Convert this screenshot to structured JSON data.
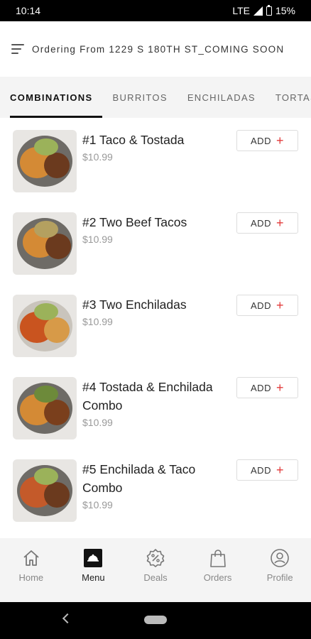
{
  "status_bar": {
    "time": "10:14",
    "network": "LTE",
    "battery": "15%"
  },
  "header": {
    "text": "Ordering From 1229 S 180TH ST_COMING SOON"
  },
  "tabs": [
    {
      "label": "COMBINATIONS",
      "active": true
    },
    {
      "label": "BURRITOS",
      "active": false
    },
    {
      "label": "ENCHILADAS",
      "active": false
    },
    {
      "label": "TORTAS",
      "active": false
    }
  ],
  "items": [
    {
      "name": "#1 Taco & Tostada",
      "price": "$10.99",
      "add_label": "ADD"
    },
    {
      "name": "#2 Two Beef Tacos",
      "price": "$10.99",
      "add_label": "ADD"
    },
    {
      "name": "#3 Two Enchiladas",
      "price": "$10.99",
      "add_label": "ADD"
    },
    {
      "name": "#4 Tostada & Enchilada Combo",
      "price": "$10.99",
      "add_label": "ADD"
    },
    {
      "name": "#5 Enchilada & Taco Combo",
      "price": "$10.99",
      "add_label": "ADD"
    }
  ],
  "bottom_nav": [
    {
      "label": "Home",
      "icon": "home-icon",
      "active": false
    },
    {
      "label": "Menu",
      "icon": "menu-cloche-icon",
      "active": true
    },
    {
      "label": "Deals",
      "icon": "deals-badge-icon",
      "active": false
    },
    {
      "label": "Orders",
      "icon": "shopping-bag-icon",
      "active": false
    },
    {
      "label": "Profile",
      "icon": "profile-icon",
      "active": false
    }
  ],
  "colors": {
    "accent_plus": "#e23b3b",
    "tab_bg": "#f4f4f4",
    "price": "#999999"
  }
}
